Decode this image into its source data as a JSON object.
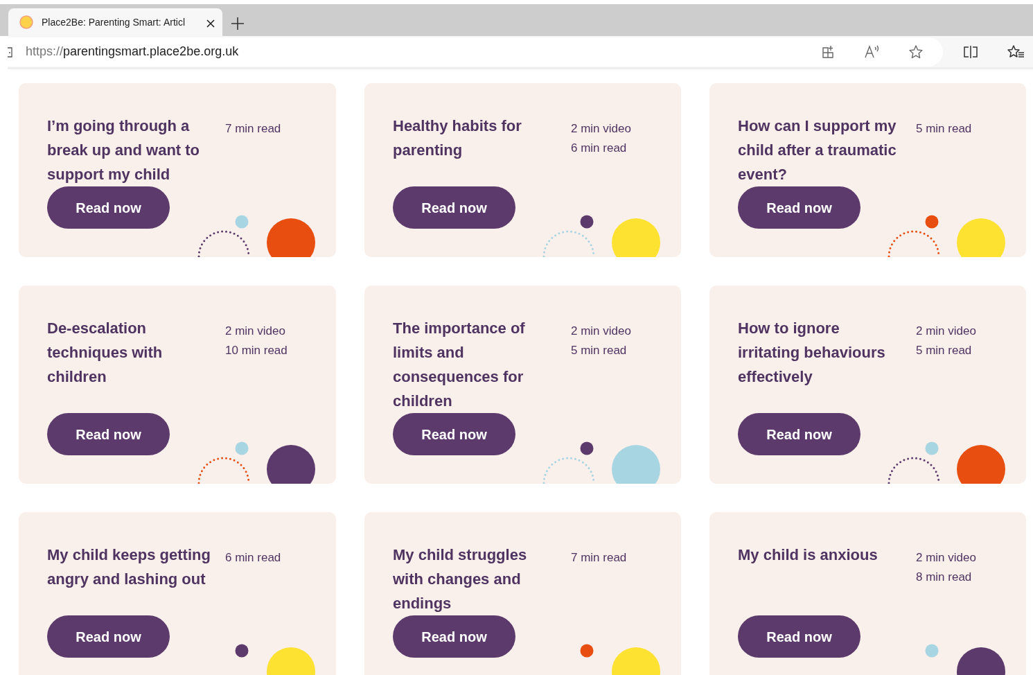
{
  "browser": {
    "tab_title": "Place2Be: Parenting Smart: Articl",
    "url_scheme": "https://",
    "url_host": "parentingsmart.place2be.org.uk"
  },
  "cards": [
    {
      "title": "I’m going through a break up and want to support my child",
      "meta": [
        "7 min read"
      ],
      "button": "Read now",
      "decoration": {
        "dot": {
          "color": "#a8d5e2"
        },
        "arc": {
          "color": "#5c3a6b"
        },
        "circle": {
          "color": "#e84e10"
        }
      }
    },
    {
      "title": "Healthy habits for parenting",
      "meta": [
        "2 min video",
        "6 min read"
      ],
      "button": "Read now",
      "decoration": {
        "dot": {
          "color": "#5c3a6b"
        },
        "arc": {
          "color": "#a8d5e2"
        },
        "circle": {
          "color": "#fde232"
        }
      }
    },
    {
      "title": "How can I support my child after a traumatic event?",
      "meta": [
        "5 min read"
      ],
      "button": "Read now",
      "decoration": {
        "dot": {
          "color": "#e84e10"
        },
        "arc": {
          "color": "#e84e10"
        },
        "circle": {
          "color": "#fde232"
        }
      }
    },
    {
      "title": "De-escalation techniques with children",
      "meta": [
        "2 min video",
        "10 min read"
      ],
      "button": "Read now",
      "decoration": {
        "dot": {
          "color": "#a8d5e2"
        },
        "arc": {
          "color": "#e84e10"
        },
        "circle": {
          "color": "#5c3a6b"
        }
      }
    },
    {
      "title": "The importance of limits and consequences for children",
      "meta": [
        "2 min video",
        "5 min read"
      ],
      "button": "Read now",
      "decoration": {
        "dot": {
          "color": "#5c3a6b"
        },
        "arc": {
          "color": "#a8d5e2"
        },
        "circle": {
          "color": "#a8d5e2"
        }
      }
    },
    {
      "title": "How to ignore irritating behaviours effectively",
      "meta": [
        "2 min video",
        "5 min read"
      ],
      "button": "Read now",
      "decoration": {
        "dot": {
          "color": "#a8d5e2"
        },
        "arc": {
          "color": "#5c3a6b"
        },
        "circle": {
          "color": "#e84e10"
        }
      }
    },
    {
      "title": "My child keeps getting angry and lashing out",
      "meta": [
        "6 min read"
      ],
      "button": "Read now",
      "decoration": {
        "dot": {
          "color": "#5c3a6b"
        },
        "circle": {
          "color": "#fde232"
        }
      }
    },
    {
      "title": "My child struggles with changes and endings",
      "meta": [
        "7 min read"
      ],
      "button": "Read now",
      "decoration": {
        "dot": {
          "color": "#e84e10"
        },
        "circle": {
          "color": "#fde232"
        }
      }
    },
    {
      "title": "My child is anxious",
      "meta": [
        "2 min video",
        "8 min read"
      ],
      "button": "Read now",
      "decoration": {
        "dot": {
          "color": "#a8d5e2"
        },
        "circle": {
          "color": "#5c3a6b"
        }
      }
    }
  ]
}
